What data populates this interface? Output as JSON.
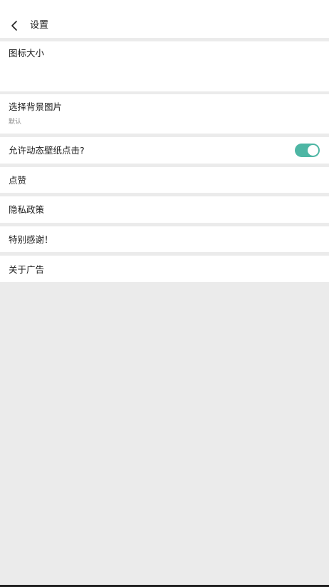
{
  "header": {
    "title": "设置",
    "back_icon": "chevron-left-icon"
  },
  "settings": {
    "icon_size": {
      "title": "图标大小"
    },
    "background": {
      "title": "选择背景图片",
      "subtitle": "默认"
    },
    "live_wallpaper_click": {
      "title": "允许动态壁纸点击?",
      "enabled": true
    },
    "like": {
      "title": "点赞"
    },
    "privacy": {
      "title": "隐私政策"
    },
    "thanks": {
      "title": "特别感谢！"
    },
    "about_ads": {
      "title": "关于广告"
    }
  },
  "colors": {
    "toggle_on": "#4db6a4",
    "background": "#ebebeb",
    "row_background": "#ffffff"
  }
}
